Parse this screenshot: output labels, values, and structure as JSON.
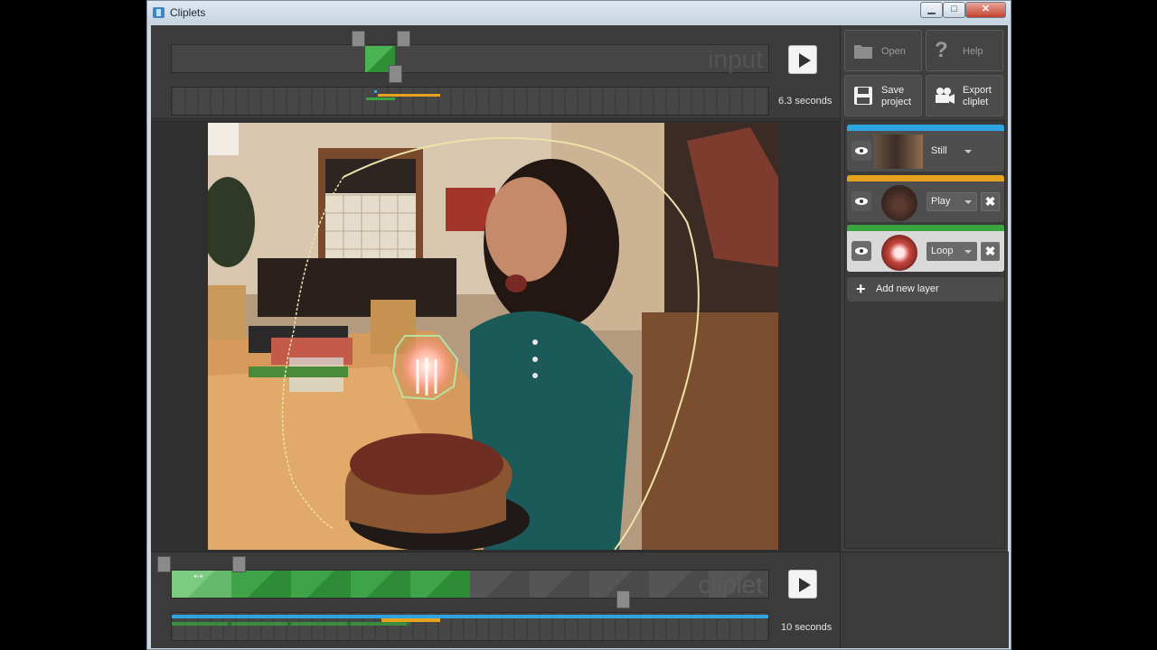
{
  "window": {
    "title": "Cliplets",
    "controls": {
      "minimize": "▁",
      "maximize": "□",
      "close": "✕"
    }
  },
  "input": {
    "watermark": "input",
    "duration": "6.3 seconds",
    "selection_color": "#3aa53f",
    "layer_spans": [
      {
        "color": "#3fa9e0",
        "start": 0.34,
        "end": 0.344
      },
      {
        "color": "#e7a21d",
        "start": 0.345,
        "end": 0.45
      },
      {
        "color": "#3aa53f",
        "start": 0.326,
        "end": 0.374
      }
    ]
  },
  "cliplet": {
    "watermark": "cliplet",
    "duration": "10 seconds",
    "segments": [
      "light",
      "green",
      "green",
      "green",
      "green",
      "dark",
      "dark",
      "dark",
      "dark",
      "dark"
    ],
    "cursor_glyph": "↔"
  },
  "toolbar": {
    "open": "Open",
    "help": "Help",
    "save": [
      "Save",
      "project"
    ],
    "export": [
      "Export",
      "cliplet"
    ]
  },
  "layers": [
    {
      "name": "layer-still",
      "color": "#2ea4e0",
      "mode": "Still",
      "removable": false
    },
    {
      "name": "layer-play",
      "color": "#e7a21d",
      "mode": "Play",
      "removable": true
    },
    {
      "name": "layer-loop",
      "color": "#3aa53f",
      "mode": "Loop",
      "removable": true,
      "selected": true
    }
  ],
  "add_layer": "Add new layer",
  "remove_glyph": "✖"
}
